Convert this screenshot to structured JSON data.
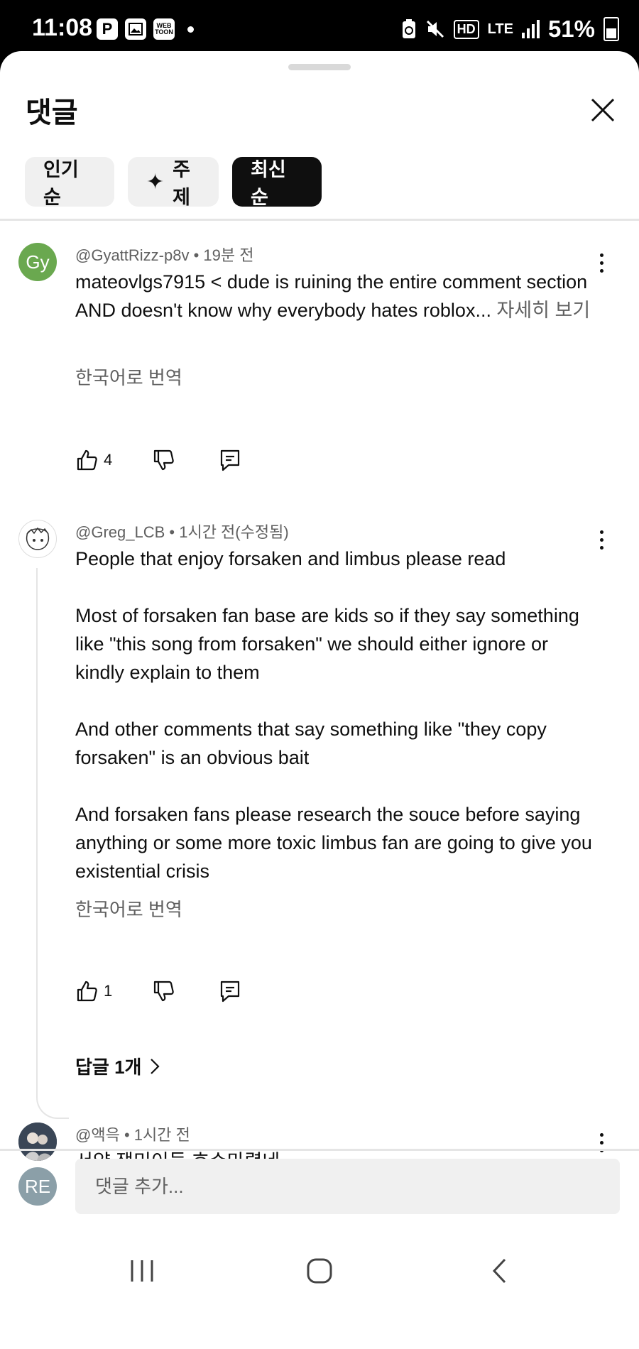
{
  "status_bar": {
    "time": "11:08",
    "left_icons": [
      "p-icon",
      "image-icon",
      "webtoon-icon"
    ],
    "lte": "LTE",
    "battery": "51%"
  },
  "sheet": {
    "title": "댓글",
    "chips": [
      {
        "label": "인기순",
        "active": false
      },
      {
        "label": "주제",
        "icon": "sparkle-icon",
        "active": false
      },
      {
        "label": "최신순",
        "active": true
      }
    ]
  },
  "comments": [
    {
      "avatar_text": "Gy",
      "avatar_color": "#6aa84f",
      "author": "@GyattRizz-p8v",
      "time": "19분 전",
      "body": "mateovlgs7915 < dude is ruining the entire comment section\nAND doesn't know why everybody hates roblox...",
      "more": "자세히 보기",
      "translate": "한국어로 번역",
      "likes": "4"
    },
    {
      "avatar_icon": "drawn-avatar",
      "author": "@Greg_LCB",
      "time": "1시간 전(수정됨)",
      "body": "People that enjoy forsaken and limbus please read\n\nMost of forsaken fan base are kids so if they say something like \"this song from forsaken\" we should either ignore or kindly explain to them\n\nAnd other comments that say something like \"they copy forsaken\" is an obvious bait\n\nAnd forsaken fans please research the souce before saying anything or some more toxic limbus fan are going to give you existential crisis",
      "translate": "한국어로 번역",
      "likes": "1",
      "replies": "답글 1개"
    },
    {
      "avatar_icon": "photo-avatar",
      "author": "@액윽",
      "time": "1시간 전",
      "body": "서양 잼민이들 효수마렵네"
    }
  ],
  "compose": {
    "avatar_text": "RE",
    "placeholder": "댓글 추가..."
  }
}
